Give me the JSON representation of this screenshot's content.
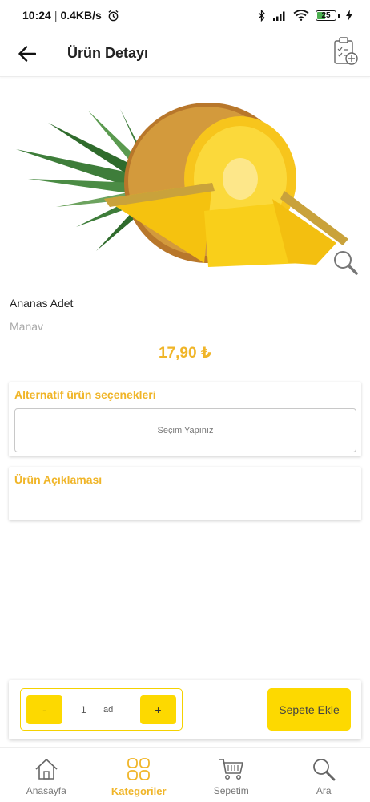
{
  "status_bar": {
    "time": "10:24",
    "speed": "0.4KB/s",
    "battery": "25"
  },
  "header": {
    "title": "Ürün Detayı"
  },
  "product": {
    "name": "Ananas Adet",
    "category": "Manav",
    "price": "17,90 ₺"
  },
  "alternatives": {
    "title": "Alternatif ürün seçenekleri",
    "select_placeholder": "Seçim Yapınız"
  },
  "description": {
    "title": "Ürün Açıklaması"
  },
  "cart_bar": {
    "minus_label": "-",
    "plus_label": "+",
    "quantity": "1",
    "unit": "ad",
    "add_label": "Sepete Ekle"
  },
  "bottom_nav": {
    "items": [
      {
        "label": "Anasayfa",
        "icon": "home-icon"
      },
      {
        "label": "Kategoriler",
        "icon": "grid-icon"
      },
      {
        "label": "Sepetim",
        "icon": "cart-icon"
      },
      {
        "label": "Ara",
        "icon": "search-icon"
      }
    ],
    "active": "Kategoriler"
  },
  "colors": {
    "accent": "#f0b528",
    "button_yellow": "#fdd900"
  }
}
